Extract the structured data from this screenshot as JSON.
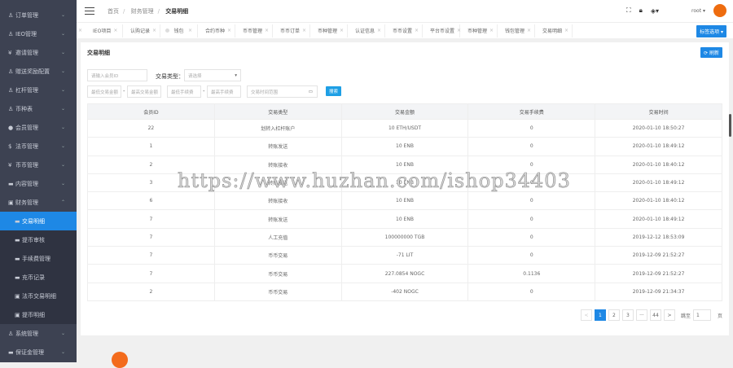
{
  "sidebar": {
    "items": [
      {
        "label": "订单管理",
        "icon": "chart"
      },
      {
        "label": "IEO管理",
        "icon": "chart"
      },
      {
        "label": "邀请管理",
        "icon": "yen"
      },
      {
        "label": "赠送奖励配置",
        "icon": "chart"
      },
      {
        "label": "杠杆管理",
        "icon": "chart"
      },
      {
        "label": "币种表",
        "icon": "chart"
      },
      {
        "label": "会员管理",
        "icon": "user"
      },
      {
        "label": "法币管理",
        "icon": "dollar"
      },
      {
        "label": "币币管理",
        "icon": "yen"
      },
      {
        "label": "内容管理",
        "icon": "doc"
      },
      {
        "label": "财务管理",
        "icon": "calc"
      }
    ],
    "sub_items": [
      {
        "label": "交易明细"
      },
      {
        "label": "提币审核"
      },
      {
        "label": "手续费管理"
      },
      {
        "label": "充币记录"
      },
      {
        "label": "法币交易明细"
      },
      {
        "label": "提币明细"
      }
    ],
    "bottom_items": [
      {
        "label": "系统管理"
      },
      {
        "label": "保证金管理"
      }
    ]
  },
  "header": {
    "breadcrumb": [
      "首页",
      "财务管理",
      "交易明细"
    ],
    "user": "root ▾"
  },
  "tabs": [
    "IEO项目",
    "认购记录",
    "钱包",
    "合约币种",
    "币币管理",
    "币币订单",
    "币种管理",
    "认证信息",
    "币币设置",
    "平台币设置",
    "币种管理",
    "钱包管理",
    "交易明细"
  ],
  "tab_options": "标签选项 ▾",
  "card": {
    "title": "交易明细",
    "refresh": "⟳ 刷新"
  },
  "filters": {
    "member_id_placeholder": "请输入会员ID",
    "type_label": "交易类型：",
    "type_placeholder": "请选择",
    "min_amount": "最低交易金额",
    "max_amount": "最高交易金额",
    "min_fee": "最低手续费",
    "max_fee": "最高手续费",
    "time_range": "交易时间范围",
    "search": "搜索"
  },
  "table": {
    "headers": [
      "会员ID",
      "交易类型",
      "交易金额",
      "交易手续费",
      "交易时间"
    ],
    "rows": [
      [
        "22",
        "划转入杠杆账户",
        "10 ETH/USDT",
        "0",
        "2020-01-10 18:50:27"
      ],
      [
        "1",
        "转账发送",
        "10 ENB",
        "0",
        "2020-01-10 18:49:12"
      ],
      [
        "2",
        "转账接收",
        "10 ENB",
        "0",
        "2020-01-10 18:40:12"
      ],
      [
        "3",
        "转账发送",
        "10 ENB",
        "0",
        "2020-01-10 18:49:12"
      ],
      [
        "6",
        "转账接收",
        "10 ENB",
        "0",
        "2020-01-10 18:40:12"
      ],
      [
        "7",
        "转账发送",
        "10 ENB",
        "0",
        "2020-01-10 18:49:12"
      ],
      [
        "7",
        "人工充值",
        "100000000 TGB",
        "0",
        "2019-12-12 18:53:09"
      ],
      [
        "7",
        "币币交易",
        "-71 LIT",
        "0",
        "2019-12-09 21:52:27"
      ],
      [
        "7",
        "币币交易",
        "227.0854 NOGC",
        "0.1136",
        "2019-12-09 21:52:27"
      ],
      [
        "2",
        "币币交易",
        "-402 NOGC",
        "0",
        "2019-12-09 21:34:37"
      ]
    ]
  },
  "pagination": {
    "pages": [
      "1",
      "2",
      "3",
      "···",
      "44"
    ],
    "prev": "<",
    "next": ">",
    "goto": "跳至",
    "current": "1",
    "page_unit": "页"
  },
  "watermark": "https://www.huzhan.com/ishop34403",
  "colors": {
    "accent": "#1e88e5",
    "sidebar": "#3d4252"
  }
}
